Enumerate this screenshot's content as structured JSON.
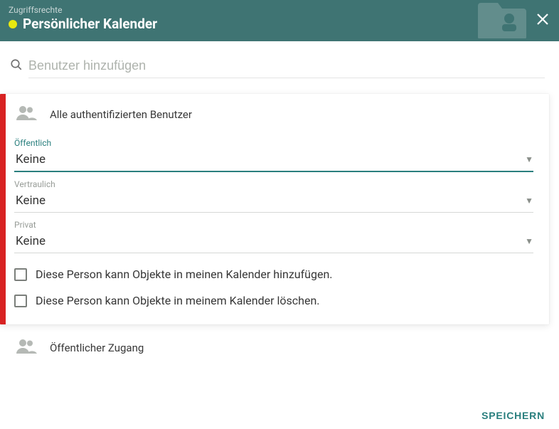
{
  "header": {
    "subtitle": "Zugriffsrechte",
    "title": "Persönlicher Kalender"
  },
  "search": {
    "placeholder": "Benutzer hinzufügen"
  },
  "card": {
    "user_label": "Alle authentifizierten Benutzer",
    "fields": {
      "public": {
        "label": "Öffentlich",
        "value": "Keine"
      },
      "confidential": {
        "label": "Vertraulich",
        "value": "Keine"
      },
      "private": {
        "label": "Privat",
        "value": "Keine"
      }
    },
    "checkboxes": {
      "can_add": "Diese Person kann Objekte in meinen Kalender hinzufügen.",
      "can_delete": "Diese Person kann Objekte in meinem Kalender löschen."
    }
  },
  "public_access": {
    "label": "Öffentlicher Zugang"
  },
  "footer": {
    "save": "Speichern"
  }
}
